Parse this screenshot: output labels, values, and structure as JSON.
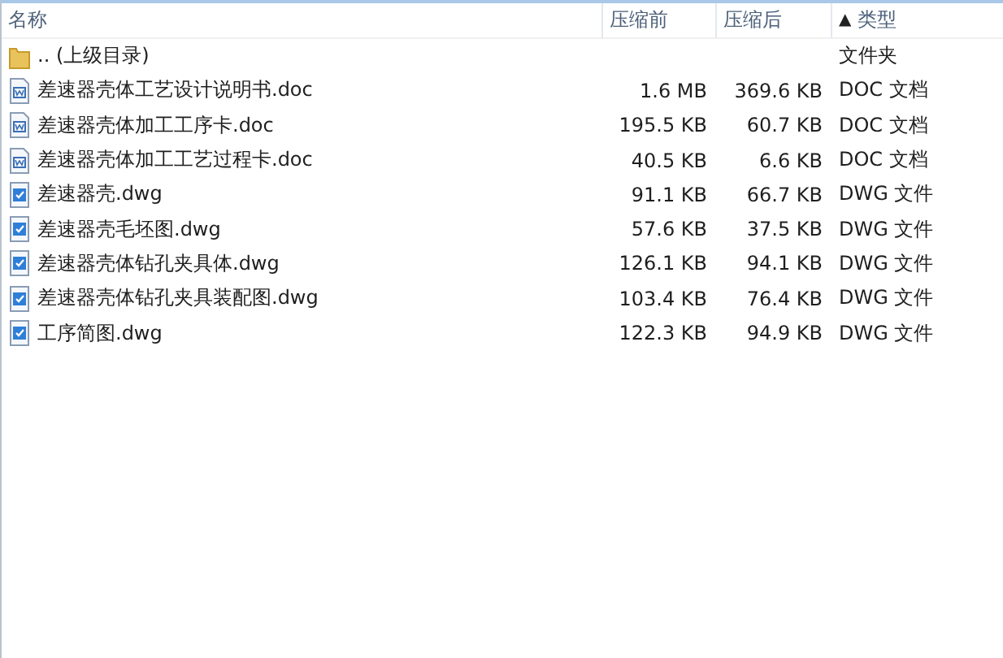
{
  "columns": [
    {
      "label": "名称"
    },
    {
      "label": "压缩前"
    },
    {
      "label": "压缩后"
    },
    {
      "label": "类型",
      "sort_indicator": "▲"
    }
  ],
  "rows": [
    {
      "kind": "folder",
      "name": ".. (上级目录)",
      "type": "文件夹"
    },
    {
      "kind": "doc",
      "name": "差速器壳体工艺设计说明书.doc",
      "size": "1.6 MB",
      "packed": "369.6 KB",
      "type": "DOC 文档"
    },
    {
      "kind": "doc",
      "name": "差速器壳体加工工序卡.doc",
      "size": "195.5 KB",
      "packed": "60.7 KB",
      "type": "DOC 文档"
    },
    {
      "kind": "doc",
      "name": "差速器壳体加工工艺过程卡.doc",
      "size": "40.5 KB",
      "packed": "6.6 KB",
      "type": "DOC 文档"
    },
    {
      "kind": "dwg",
      "name": "差速器壳.dwg",
      "size": "91.1 KB",
      "packed": "66.7 KB",
      "type": "DWG 文件"
    },
    {
      "kind": "dwg",
      "name": "差速器壳毛坯图.dwg",
      "size": "57.6 KB",
      "packed": "37.5 KB",
      "type": "DWG 文件"
    },
    {
      "kind": "dwg",
      "name": "差速器壳体钻孔夹具体.dwg",
      "size": "126.1 KB",
      "packed": "94.1 KB",
      "type": "DWG 文件"
    },
    {
      "kind": "dwg",
      "name": "差速器壳体钻孔夹具装配图.dwg",
      "size": "103.4 KB",
      "packed": "76.4 KB",
      "type": "DWG 文件"
    },
    {
      "kind": "dwg",
      "name": "工序简图.dwg",
      "size": "122.3 KB",
      "packed": "94.9 KB",
      "type": "DWG 文件"
    }
  ]
}
